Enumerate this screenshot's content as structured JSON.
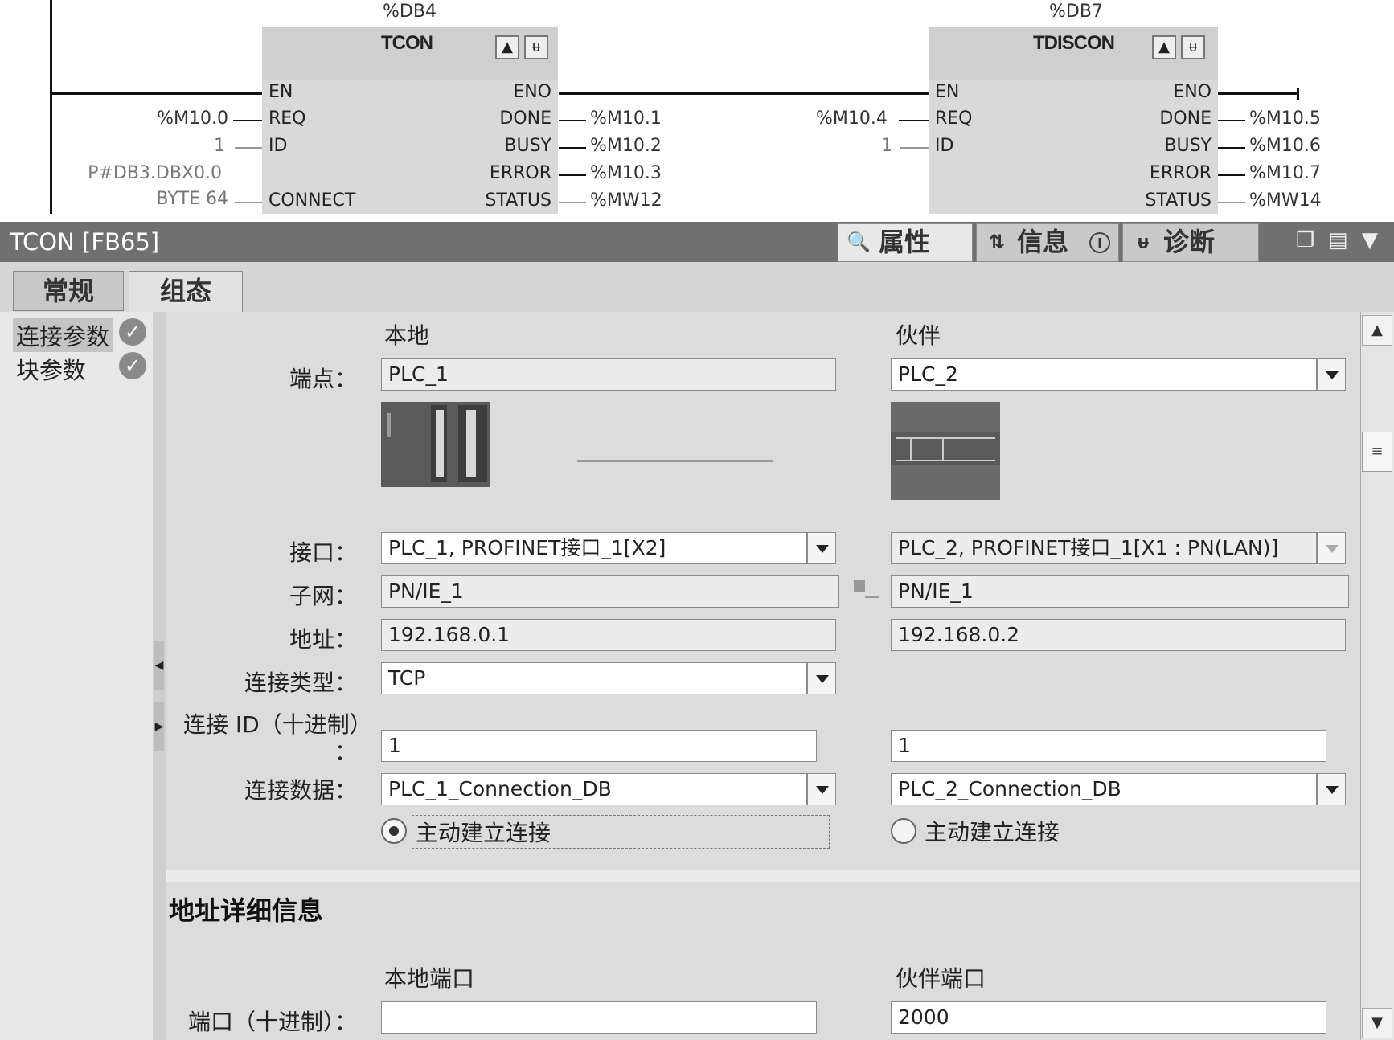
{
  "ladder": {
    "block1": {
      "db": "%DB4",
      "name": "TCON",
      "inputs": [
        "EN",
        "REQ",
        "ID",
        "CONNECT"
      ],
      "outputs": [
        "ENO",
        "DONE",
        "BUSY",
        "ERROR",
        "STATUS"
      ],
      "req_operand": "%M10.0",
      "id_operand": "1",
      "connect_operand_line1": "P#DB3.DBX0.0",
      "connect_operand_line2": "BYTE 64",
      "done_operand": "%M10.1",
      "busy_operand": "%M10.2",
      "error_operand": "%M10.3",
      "status_operand": "%MW12"
    },
    "block2": {
      "db": "%DB7",
      "name": "TDISCON",
      "inputs": [
        "EN",
        "REQ",
        "ID"
      ],
      "outputs": [
        "ENO",
        "DONE",
        "BUSY",
        "ERROR",
        "STATUS"
      ],
      "req_operand": "%M10.4",
      "id_operand": "1",
      "done_operand": "%M10.5",
      "busy_operand": "%M10.6",
      "error_operand": "%M10.7",
      "status_operand": "%MW14"
    }
  },
  "inspector": {
    "title": "TCON [FB65]",
    "tabs": {
      "properties": "属性",
      "info": "信息",
      "diagnostics": "诊断"
    },
    "subtabs": {
      "general": "常规",
      "configuration": "组态"
    },
    "nav": {
      "conn_params": "连接参数",
      "block_params": "块参数"
    },
    "headers": {
      "local": "本地",
      "partner": "伙伴"
    },
    "labels": {
      "endpoint": "端点：",
      "interface": "接口：",
      "subnet": "子网：",
      "address": "地址：",
      "conn_type": "连接类型：",
      "conn_id_1": "连接 ID（十进制）",
      "conn_id_2": "：",
      "conn_data": "连接数据：",
      "port": "端口（十进制）："
    },
    "local": {
      "endpoint": "PLC_1",
      "interface": "PLC_1, PROFINET接口_1[X2]",
      "subnet": "PN/IE_1",
      "address": "192.168.0.1",
      "conn_type": "TCP",
      "conn_id": "1",
      "conn_data": "PLC_1_Connection_DB",
      "active": "主动建立连接",
      "port": ""
    },
    "partner": {
      "endpoint": "PLC_2",
      "interface": "PLC_2, PROFINET接口_1[X1 : PN(LAN)]",
      "subnet": "PN/IE_1",
      "address": "192.168.0.2",
      "conn_id": "1",
      "conn_data": "PLC_2_Connection_DB",
      "active": "主动建立连接",
      "port": "2000"
    },
    "address_section": {
      "title": "地址详细信息",
      "local_port": "本地端口",
      "partner_port": "伙伴端口"
    }
  }
}
